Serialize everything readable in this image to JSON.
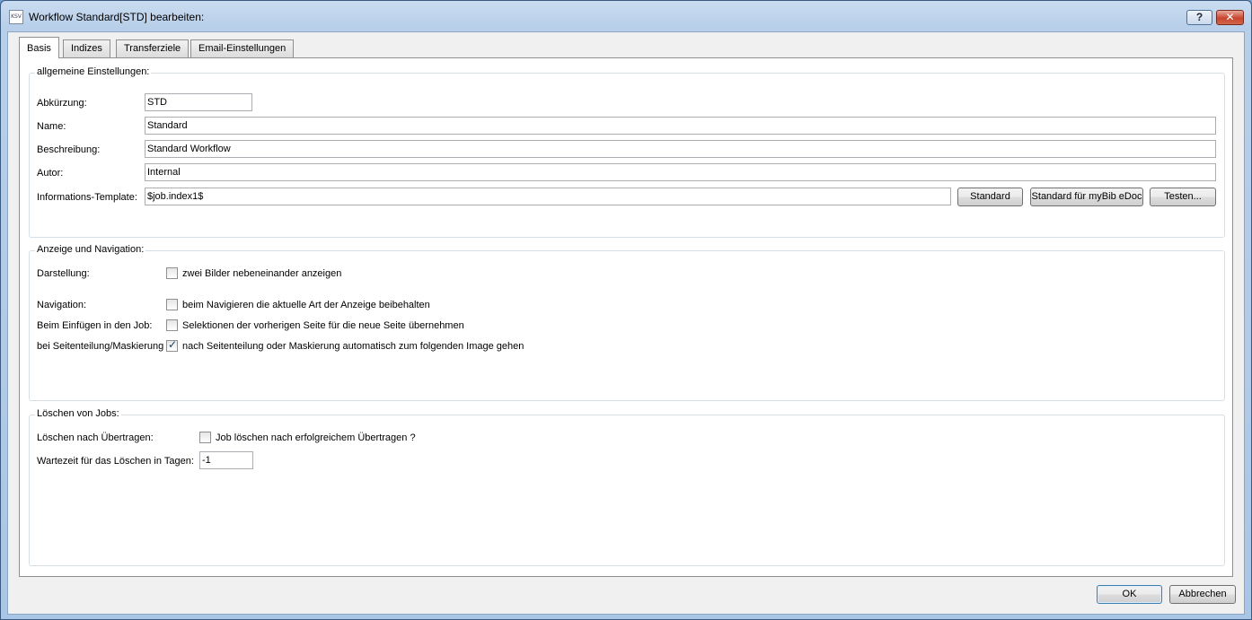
{
  "window": {
    "title": "Workflow Standard[STD] bearbeiten:",
    "icon_text": "KSV",
    "help_label": "?",
    "close_label": "✕"
  },
  "tabs": [
    {
      "label": "Basis",
      "active": true
    },
    {
      "label": "Indizes",
      "active": false
    },
    {
      "label": "Transferziele",
      "active": false
    },
    {
      "label": "Email-Einstellungen",
      "active": false
    }
  ],
  "general": {
    "title": "allgemeine Einstellungen:",
    "abbreviation": {
      "label": "Abkürzung:",
      "value": "STD"
    },
    "name": {
      "label": "Name:",
      "value": "Standard"
    },
    "description": {
      "label": "Beschreibung:",
      "value": "Standard Workflow"
    },
    "author": {
      "label": "Autor:",
      "value": "Internal"
    },
    "template": {
      "label": "Informations-Template:",
      "value": "$job.index1$",
      "btn_standard": "Standard",
      "btn_mybib": "Standard für myBib eDoc",
      "btn_test": "Testen..."
    }
  },
  "display": {
    "title": "Anzeige und Navigation:",
    "rows": [
      {
        "label": "Darstellung:",
        "checkbox_label": "zwei Bilder nebeneinander anzeigen",
        "checked": false
      },
      {
        "label": "Navigation:",
        "checkbox_label": "beim Navigieren die aktuelle Art der Anzeige beibehalten",
        "checked": false
      },
      {
        "label": "Beim Einfügen in den Job:",
        "checkbox_label": "Selektionen der vorherigen Seite für die neue Seite übernehmen",
        "checked": false
      },
      {
        "label": "bei Seitenteilung/Maskierung",
        "checkbox_label": "nach Seitenteilung oder Maskierung automatisch zum folgenden Image gehen",
        "checked": true
      }
    ]
  },
  "deletion": {
    "title": "Löschen von Jobs:",
    "delete_after": {
      "label": "Löschen nach Übertragen:",
      "checkbox_label": "Job löschen nach erfolgreichem Übertragen ?",
      "checked": false
    },
    "wait_days": {
      "label": "Wartezeit für das Löschen in Tagen:",
      "value": "-1"
    }
  },
  "footer": {
    "ok_label": "OK",
    "cancel_label": "Abbrechen"
  },
  "check_mark": "✓"
}
